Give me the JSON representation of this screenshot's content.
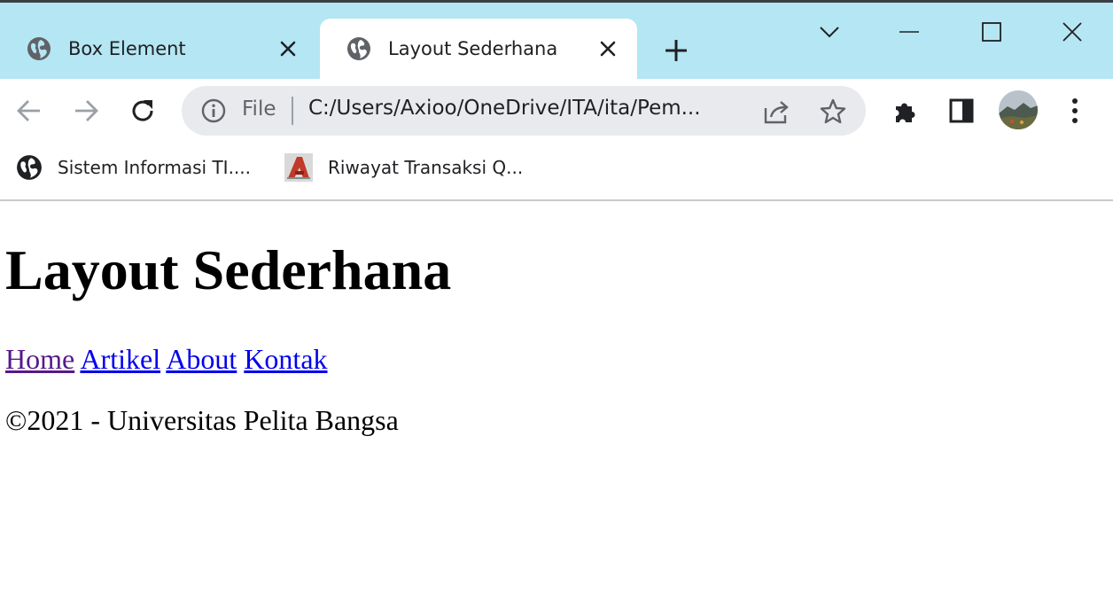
{
  "browser": {
    "tabs": [
      {
        "title": "Box Element",
        "active": false,
        "icon": "globe-icon"
      },
      {
        "title": "Layout Sederhana",
        "active": true,
        "icon": "globe-icon"
      }
    ],
    "tabstrip_color": "#b4e6f3"
  },
  "omnibox": {
    "scheme_label": "File",
    "url": "C:/Users/Axioo/OneDrive/ITA/ita/Pem..."
  },
  "bookmarks": [
    {
      "label": "Sistem Informasi TI....",
      "icon": "globe-icon"
    },
    {
      "label": "Riwayat Transaksi Q...",
      "icon": "app-logo-icon"
    }
  ],
  "page": {
    "heading": "Layout Sederhana",
    "nav_links": [
      "Home",
      "Artikel",
      "About",
      "Kontak"
    ],
    "footer": "©2021 - Universitas Pelita Bangsa",
    "link_color": "#0000ee",
    "visited_link_color": "#551a8b"
  }
}
